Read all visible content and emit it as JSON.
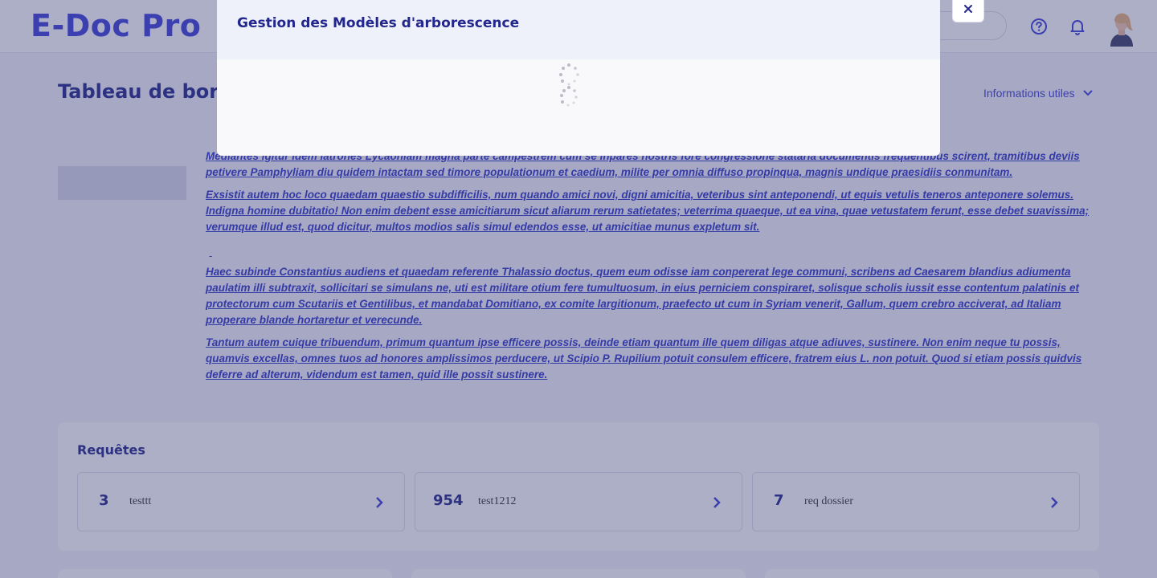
{
  "header": {
    "logo": "E-Doc Pro",
    "icons": [
      "help-icon",
      "bell-icon",
      "avatar"
    ]
  },
  "page": {
    "title": "Tableau de bord",
    "info_toggle": "Informations utiles"
  },
  "paragraphs": [
    "Mediantes igitur idem latrones Lycaoniam magna parte campestrem cum se inpares nostris fore congressione stataria documentis frequentibus scirent, tramitibus deviis petivere Pamphyliam diu quidem intactam sed timore populationum et caedium, milite per omnia diffuso propinqua, magnis undique praesidiis conmunitam.",
    "Exsistit autem hoc loco quaedam quaestio subdifficilis, num quando amici novi, digni amicitia, veteribus sint anteponendi, ut equis vetulis teneros anteponere solemus. Indigna homine dubitatio! Non enim debent esse amicitiarum sicut aliarum rerum satietates; veterrima quaeque, ut ea vina, quae vetustatem ferunt, esse debet suavissima; verumque illud est, quod dicitur, multos modios salis simul edendos esse, ut amicitiae munus expletum sit.",
    "Haec subinde Constantius audiens et quaedam referente Thalassio doctus, quem eum odisse iam conpererat lege communi, scribens ad Caesarem blandius adiumenta paulatim illi subtraxit, sollicitari se simulans ne, uti est militare otium fere tumultuosum, in eius perniciem conspiraret, solisque scholis iussit esse contentum palatinis et protectorum cum Scutariis et Gentilibus, et mandabat Domitiano, ex comite largitionum, praefecto ut cum in Syriam venerit, Gallum, quem crebro acciverat, ad Italiam properare blande hortaretur et verecunde.",
    "Tantum autem cuique tribuendum, primum quantum ipse efficere possis, deinde etiam quantum ille quem diligas atque adiuves, sustinere. Non enim neque tu possis, quamvis excellas, omnes tuos ad honores amplissimos perducere, ut Scipio P. Rupilium potuit consulem efficere, fratrem eius L. non potuit. Quod si etiam possis quidvis deferre ad alterum, videndum est tamen, quid ille possit sustinere."
  ],
  "dash": "-",
  "requests": {
    "title": "Requêtes",
    "items": [
      {
        "count": "3",
        "label": "testtt"
      },
      {
        "count": "954",
        "label": "test1212"
      },
      {
        "count": "7",
        "label": "req dossier"
      }
    ]
  },
  "modal": {
    "title": "Gestion des Modèles d'arborescence",
    "close_icon": "close-icon",
    "loading": "spinner"
  },
  "colors": {
    "brand": "#3b3fd8",
    "title": "#23268a",
    "overlay": "rgba(60,64,120,0.42)"
  }
}
